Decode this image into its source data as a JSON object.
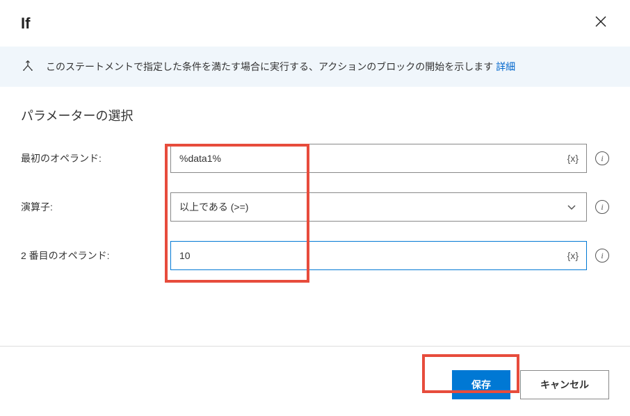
{
  "dialog": {
    "title": "If",
    "close_label": "×"
  },
  "banner": {
    "text": "このステートメントで指定した条件を満たす場合に実行する、アクションのブロックの開始を示します ",
    "link_label": "詳細"
  },
  "params": {
    "section_title": "パラメーターの選択",
    "first_operand": {
      "label": "最初のオペランド:",
      "value": "%data1%"
    },
    "operator": {
      "label": "演算子:",
      "value": "以上である (>=)"
    },
    "second_operand": {
      "label": "2 番目のオペランド:",
      "value": "10"
    }
  },
  "footer": {
    "save_label": "保存",
    "cancel_label": "キャンセル"
  },
  "icons": {
    "variable_token": "{x}",
    "info": "i"
  }
}
